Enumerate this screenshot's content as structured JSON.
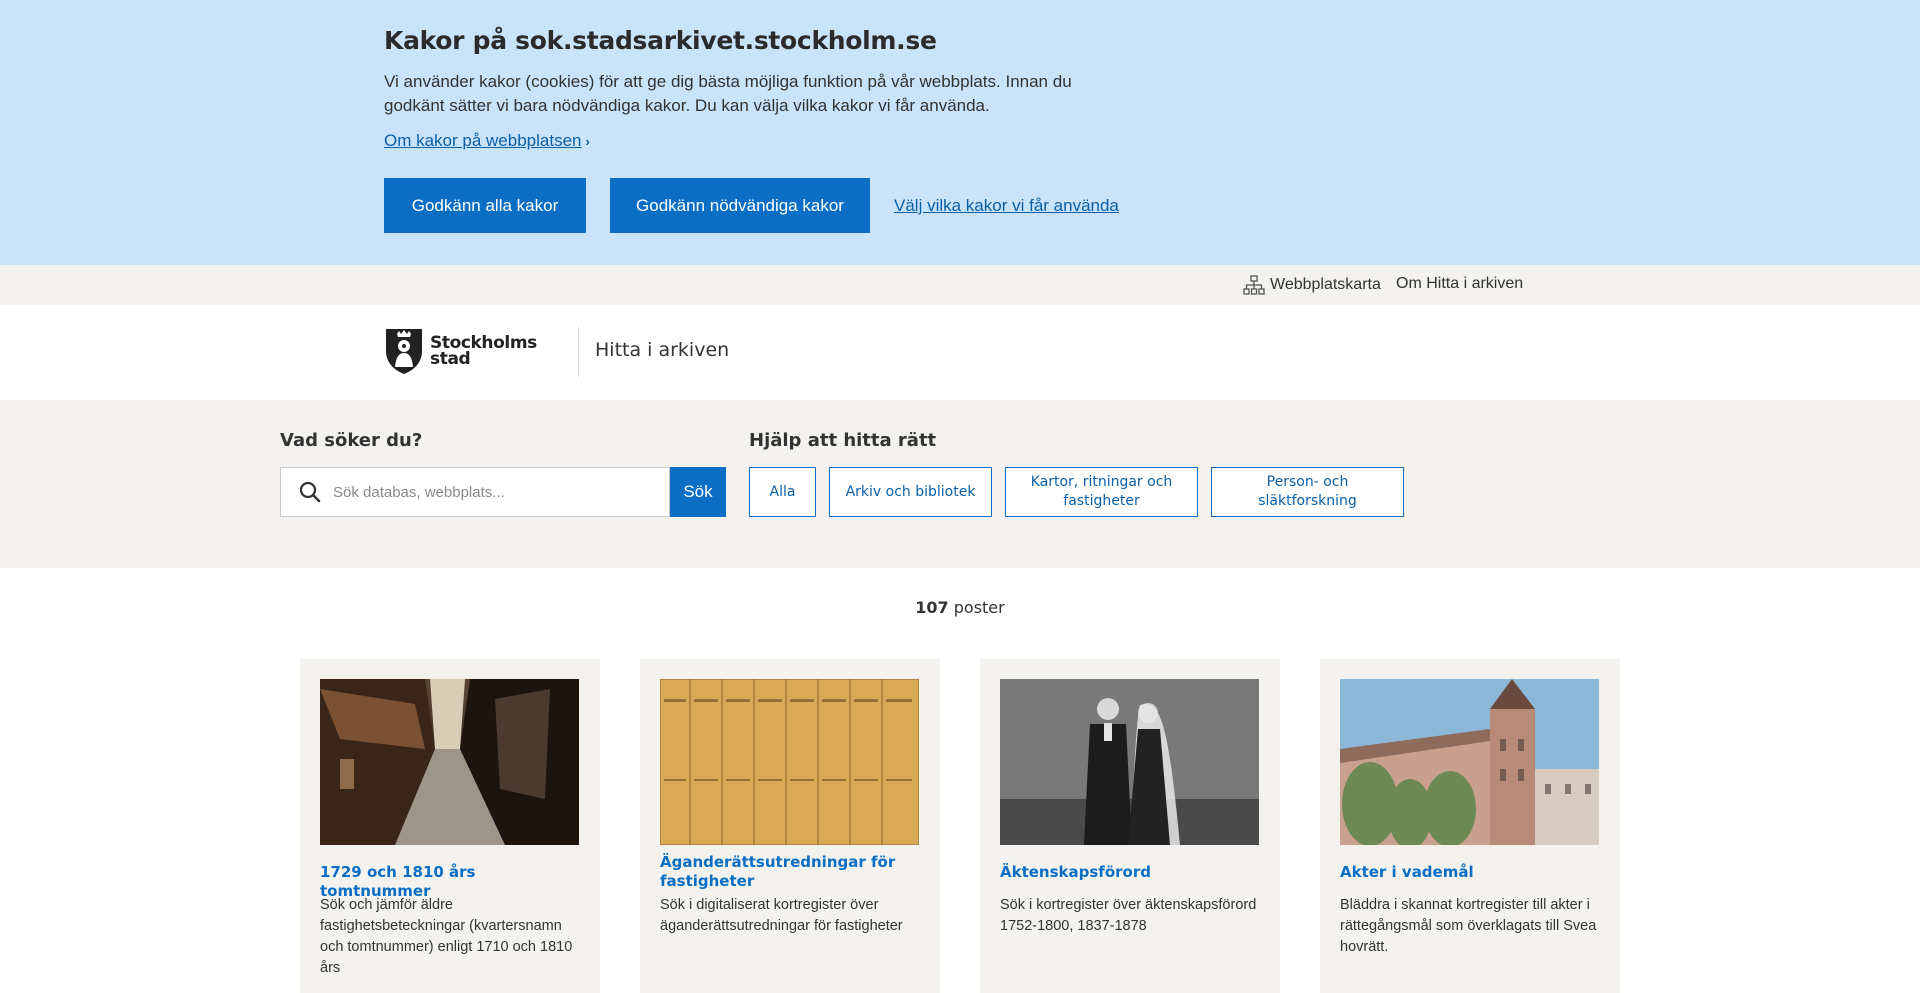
{
  "cookie_banner": {
    "title": "Kakor på sok.stadsarkivet.stockholm.se",
    "text": "Vi använder kakor (cookies) för att ge dig bästa möjliga funktion på vår webbplats. Innan du godkänt sätter vi bara nödvändiga kakor. Du kan välja vilka kakor vi får använda.",
    "info_link": "Om kakor på webbplatsen",
    "accept_all": "Godkänn alla kakor",
    "accept_necessary": "Godkänn nödvändiga kakor",
    "choose_link": "Välj vilka kakor vi får använda"
  },
  "utility_nav": {
    "sitemap": "Webbplatskarta",
    "about": "Om Hitta i arkiven"
  },
  "header": {
    "logo_line1": "Stockholms",
    "logo_line2": "stad",
    "site_name": "Hitta i arkiven"
  },
  "search": {
    "heading": "Vad söker du?",
    "placeholder": "Sök databas, webbplats...",
    "button": "Sök"
  },
  "help": {
    "heading": "Hjälp att hitta rätt",
    "filters": [
      "Alla",
      "Arkiv och bibliotek",
      "Kartor, ritningar och fastigheter",
      "Person- och släktforskning"
    ]
  },
  "results": {
    "count": "107",
    "label": "poster"
  },
  "cards": [
    {
      "title": "1729 och 1810 års tomtnummer",
      "description": "Sök och jämför äldre fastighetsbeteckningar (kvartersnamn och tomtnummer) enligt 1710 och 1810 års"
    },
    {
      "title": "Äganderättsutredningar för fastigheter",
      "description": "Sök i digitaliserat kortregister över äganderättsutredningar för fastigheter"
    },
    {
      "title": "Äktenskapsförord",
      "description": "Sök i kortregister över äktenskapsförord 1752-1800, 1837-1878"
    },
    {
      "title": "Akter i vademål",
      "description": "Bläddra i skannat kortregister till akter i rättegångsmål som överklagats till Svea hovrätt."
    }
  ],
  "colors": {
    "cookie_bg": "#c9e3fb",
    "primary_blue": "#0a6ec4",
    "link_blue": "#0a5fa6",
    "beige_bg": "#f4f2ee"
  }
}
